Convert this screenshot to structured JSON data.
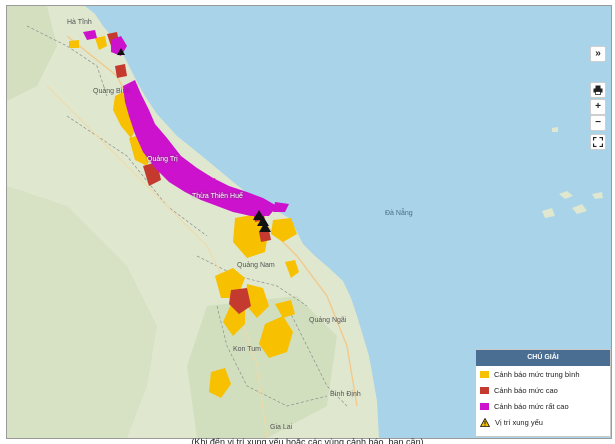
{
  "places": {
    "ha_tinh": "Hà Tĩnh",
    "quang_binh": "Quảng Bình",
    "quang_tri": "Quảng Trị",
    "thua_thien_hue": "Thừa Thiên Huế",
    "da_nang": "Đà Nẵng",
    "quang_nam": "Quảng Nam",
    "quang_ngai": "Quảng Ngãi",
    "kon_tum": "Kon Tum",
    "binh_dinh": "Bình Định",
    "gia_lai": "Gia Lai"
  },
  "controls": {
    "expand": "»",
    "print_icon": "printer-icon",
    "zoom_in": "+",
    "zoom_out": "−",
    "fullscreen_icon": "fullscreen-icon"
  },
  "legend": {
    "title": "CHÚ GIẢI",
    "items": [
      {
        "label": "Cảnh báo mức trung bình",
        "color": "#f7c000"
      },
      {
        "label": "Cảnh báo mức cao",
        "color": "#c43a2f"
      },
      {
        "label": "Cảnh báo mức rất cao",
        "color": "#cc12cc"
      },
      {
        "label": "Vị trí xung yếu",
        "icon": "warning-triangle-icon"
      }
    ]
  },
  "caption": "(Khi đến vị trí xung yếu hoặc các vùng cảnh báo, bạn cần)"
}
